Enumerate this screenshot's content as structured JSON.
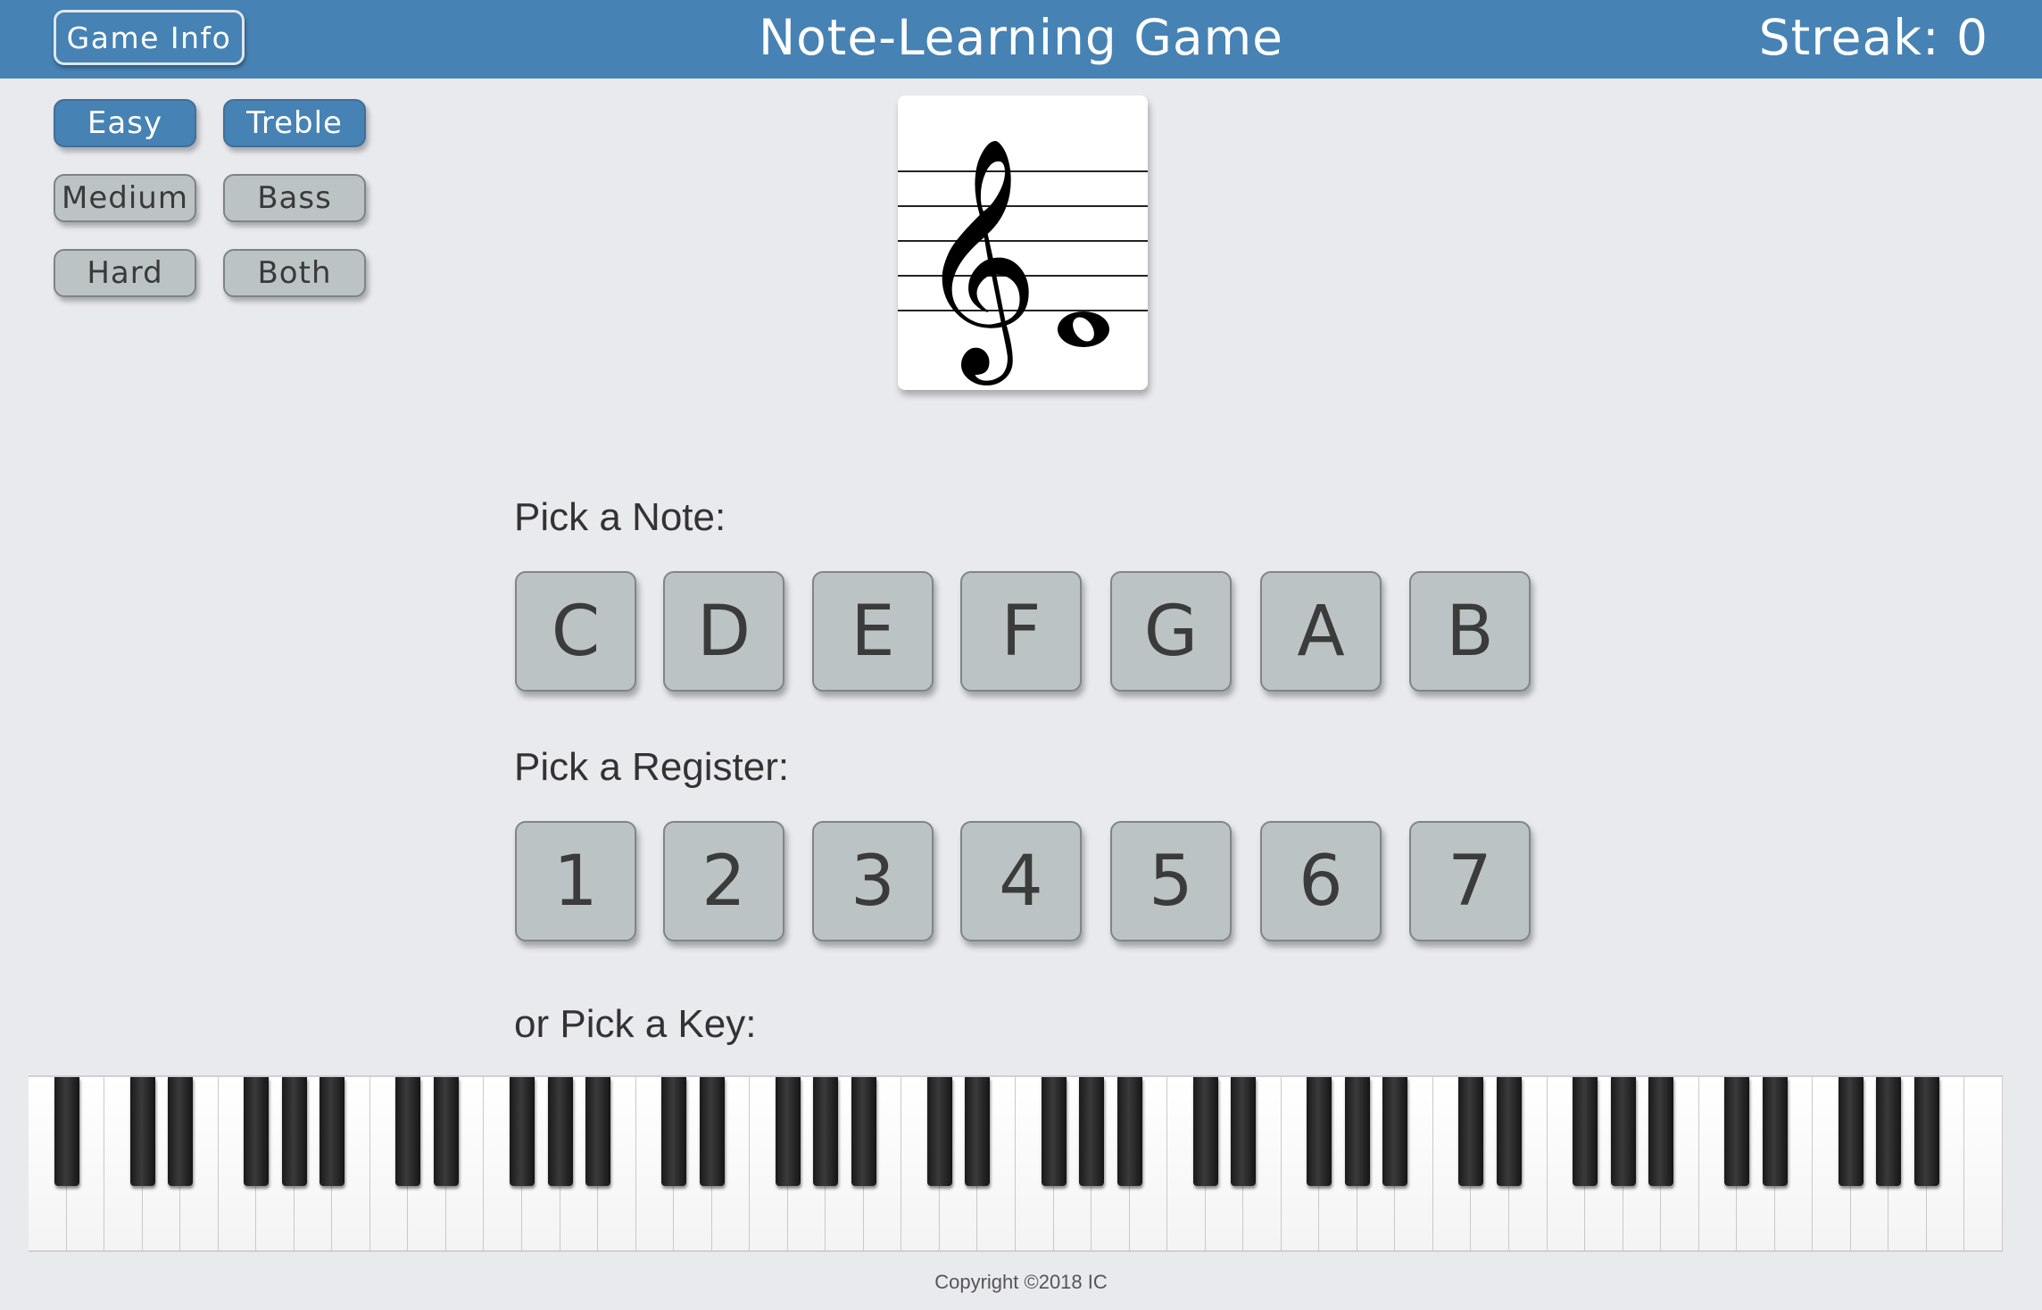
{
  "header": {
    "info_button": "Game Info",
    "title": "Note-Learning Game",
    "streak_text": "Streak: 0"
  },
  "difficulty": {
    "options": [
      "Easy",
      "Medium",
      "Hard"
    ],
    "selected": "Easy"
  },
  "clef": {
    "options": [
      "Treble",
      "Bass",
      "Both"
    ],
    "selected": "Treble"
  },
  "staff": {
    "clef_icon": "treble-clef-icon",
    "note_icon": "whole-note-icon"
  },
  "note_section": {
    "label": "Pick a Note:",
    "notes": [
      "C",
      "D",
      "E",
      "F",
      "G",
      "A",
      "B"
    ]
  },
  "register_section": {
    "label": "Pick a Register:",
    "registers": [
      "1",
      "2",
      "3",
      "4",
      "5",
      "6",
      "7"
    ]
  },
  "piano_section": {
    "label": "or Pick a Key:",
    "white_key_count": 52
  },
  "footer": {
    "copyright": "Copyright ©2018 IC"
  },
  "colors": {
    "accent": "#4682b4",
    "background": "#e9eaee",
    "button": "#bcc3c5"
  }
}
